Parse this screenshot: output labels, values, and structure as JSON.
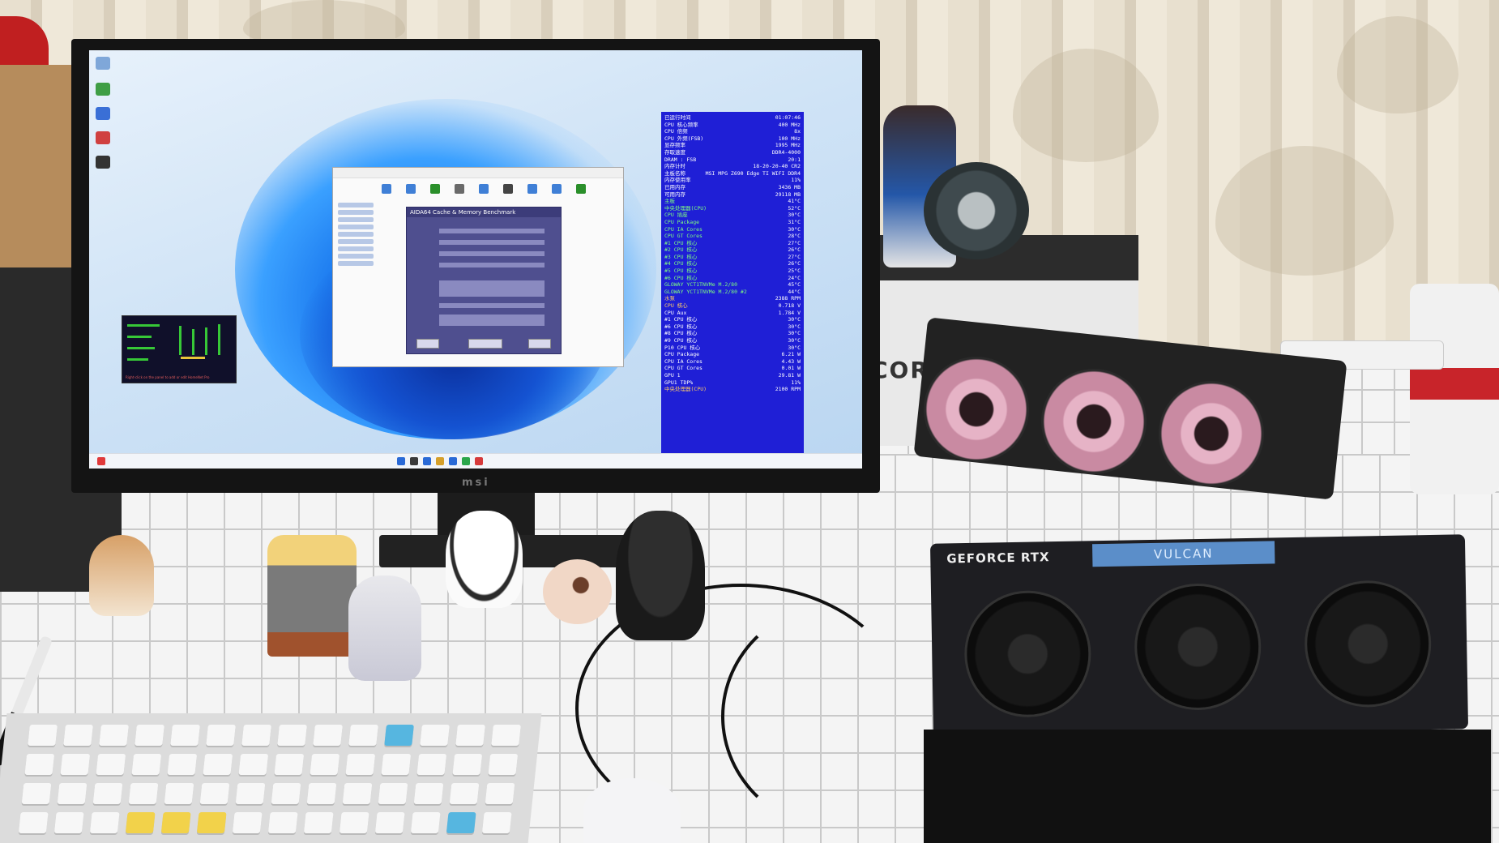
{
  "photo": {
    "monitor_brand": "msi",
    "gpu_brand_text": "GEFORCE RTX",
    "gpu_display_text": "VULCAN",
    "box_text": "CORE"
  },
  "screen": {
    "window_dialog_title": "AIDA64 Cache & Memory Benchmark",
    "widget_caption": "Right-click on the panel to add or edit HomeNet Pro"
  },
  "osd": [
    {
      "k": "已运行时间",
      "v": "01:07:46",
      "c": ""
    },
    {
      "k": "CPU 核心频率",
      "v": "400 MHz",
      "c": ""
    },
    {
      "k": "CPU 倍频",
      "v": "8x",
      "c": ""
    },
    {
      "k": "CPU 外频(FSB)",
      "v": "100 MHz",
      "c": ""
    },
    {
      "k": "显存频率",
      "v": "1995 MHz",
      "c": ""
    },
    {
      "k": "存取速度",
      "v": "DDR4-4000",
      "c": ""
    },
    {
      "k": "DRAM : FSB",
      "v": "20:1",
      "c": ""
    },
    {
      "k": "内存计时",
      "v": "18-20-20-40 CR2",
      "c": ""
    },
    {
      "k": "主板名称",
      "v": "MSI MPG Z690 Edge TI WIFI DDR4",
      "c": ""
    },
    {
      "k": "内存使用率",
      "v": "11%",
      "c": ""
    },
    {
      "k": "已用内存",
      "v": "3436 MB",
      "c": ""
    },
    {
      "k": "可用内存",
      "v": "29118 MB",
      "c": ""
    },
    {
      "k": "主板",
      "v": "41°C",
      "c": "g"
    },
    {
      "k": "中央处理器(CPU)",
      "v": "52°C",
      "c": "g"
    },
    {
      "k": "CPU 插座",
      "v": "30°C",
      "c": "g"
    },
    {
      "k": "CPU Package",
      "v": "31°C",
      "c": "g"
    },
    {
      "k": "CPU IA Cores",
      "v": "30°C",
      "c": "g"
    },
    {
      "k": "CPU GT Cores",
      "v": "28°C",
      "c": "g"
    },
    {
      "k": "#1 CPU 核心",
      "v": "27°C",
      "c": "g"
    },
    {
      "k": "#2 CPU 核心",
      "v": "26°C",
      "c": "g"
    },
    {
      "k": "#3 CPU 核心",
      "v": "27°C",
      "c": "g"
    },
    {
      "k": "#4 CPU 核心",
      "v": "26°C",
      "c": "g"
    },
    {
      "k": "#5 CPU 核心",
      "v": "25°C",
      "c": "g"
    },
    {
      "k": "#6 CPU 核心",
      "v": "24°C",
      "c": "g"
    },
    {
      "k": "GLOWAY YCT1TNVMe M.2/80",
      "v": "45°C",
      "c": "g"
    },
    {
      "k": "GLOWAY YCT1TNVMe M.2/80 #2",
      "v": "44°C",
      "c": "g"
    },
    {
      "k": "水泵",
      "v": "2388 RPM",
      "c": "o"
    },
    {
      "k": "CPU 核心",
      "v": "0.718 V",
      "c": "o"
    },
    {
      "k": "CPU Aux",
      "v": "1.784 V",
      "c": ""
    },
    {
      "k": "#1 CPU 核心",
      "v": "30°C",
      "c": ""
    },
    {
      "k": "#6 CPU 核心",
      "v": "30°C",
      "c": ""
    },
    {
      "k": "#8 CPU 核心",
      "v": "30°C",
      "c": ""
    },
    {
      "k": "#9 CPU 核心",
      "v": "30°C",
      "c": ""
    },
    {
      "k": "P10 CPU 核心",
      "v": "30°C",
      "c": ""
    },
    {
      "k": "CPU Package",
      "v": "6.21 W",
      "c": ""
    },
    {
      "k": "CPU IA Cores",
      "v": "4.43 W",
      "c": ""
    },
    {
      "k": "CPU GT Cores",
      "v": "0.01 W",
      "c": ""
    },
    {
      "k": "GPU 1",
      "v": "29.81 W",
      "c": ""
    },
    {
      "k": "GPU1 TDP%",
      "v": "11%",
      "c": ""
    },
    {
      "k": "中央处理器(CPU)",
      "v": "2100 RPM",
      "c": "o"
    }
  ]
}
